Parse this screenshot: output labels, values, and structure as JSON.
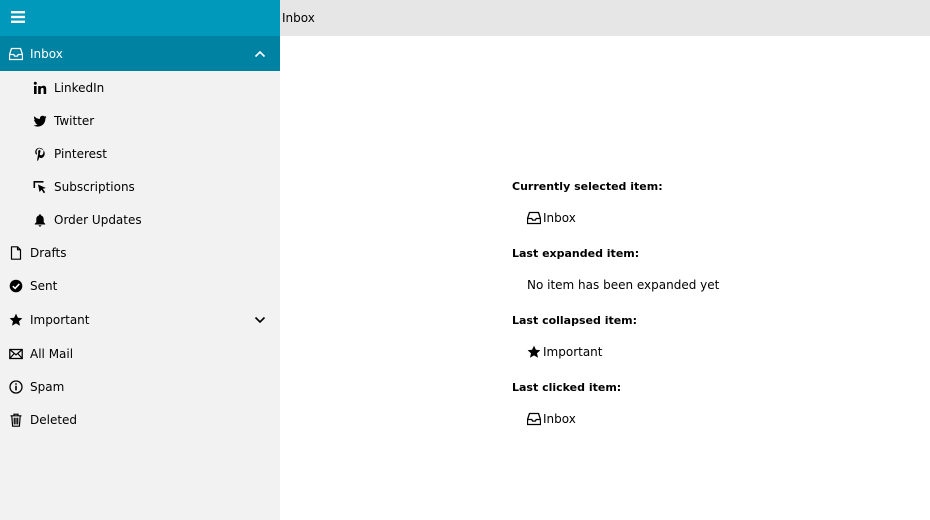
{
  "header": {
    "title": "Inbox",
    "menu_icon": "hamburger-icon"
  },
  "sidebar": {
    "items": [
      {
        "label": "Inbox",
        "icon": "inbox-icon",
        "selected": true,
        "expanded": true
      },
      {
        "label": "LinkedIn",
        "icon": "linkedin-icon",
        "child": true
      },
      {
        "label": "Twitter",
        "icon": "twitter-icon",
        "child": true
      },
      {
        "label": "Pinterest",
        "icon": "pinterest-icon",
        "child": true
      },
      {
        "label": "Subscriptions",
        "icon": "cursor-click-icon",
        "child": true
      },
      {
        "label": "Order Updates",
        "icon": "bell-icon",
        "child": true
      },
      {
        "label": "Drafts",
        "icon": "document-icon"
      },
      {
        "label": "Sent",
        "icon": "check-circle-icon"
      },
      {
        "label": "Important",
        "icon": "star-icon",
        "expandable": true
      },
      {
        "label": "All Mail",
        "icon": "envelope-icon"
      },
      {
        "label": "Spam",
        "icon": "info-icon"
      },
      {
        "label": "Deleted",
        "icon": "trash-icon"
      }
    ]
  },
  "main": {
    "selected": {
      "heading": "Currently selected item:",
      "value": "Inbox",
      "icon": "inbox-icon"
    },
    "expanded": {
      "heading": "Last expanded item:",
      "value": "No item has been expanded yet"
    },
    "collapsed": {
      "heading": "Last collapsed item:",
      "value": "Important",
      "icon": "star-icon"
    },
    "clicked": {
      "heading": "Last clicked item:",
      "value": "Inbox",
      "icon": "inbox-icon"
    }
  },
  "colors": {
    "accent": "#0099bc",
    "selected": "#0083a3",
    "sidebar_bg": "#f2f2f2",
    "topbar_bg": "#e6e6e6"
  }
}
